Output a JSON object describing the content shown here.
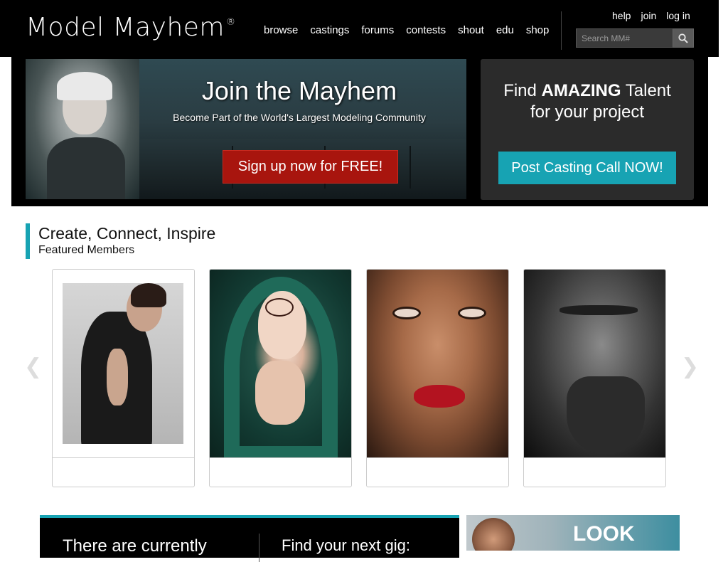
{
  "header": {
    "logo_text": "Model Mayhem",
    "logo_mark": "®",
    "nav": [
      "browse",
      "castings",
      "forums",
      "contests",
      "shout",
      "edu",
      "shop"
    ],
    "user_links": [
      "help",
      "join",
      "log in"
    ],
    "search_placeholder": "Search MM#"
  },
  "hero": {
    "title": "Join the Mayhem",
    "subtitle": "Become Part of the World's Largest Modeling Community",
    "signup_label": "Sign up now for FREE!",
    "talent_prefix": "Find ",
    "talent_emphasis": "AMAZING",
    "talent_suffix": " Talent",
    "talent_line2": "for your project",
    "post_label": "Post Casting Call NOW!"
  },
  "featured": {
    "title": "Create, Connect, Inspire",
    "subtitle": "Featured Members",
    "prev_icon": "chevron-left-icon",
    "next_icon": "chevron-right-icon"
  },
  "bottom": {
    "gig_left": "There are currently",
    "gig_right": "Find your next gig:",
    "look_text": "LOOK"
  },
  "colors": {
    "accent": "#17a3b3",
    "signup": "#a8150e",
    "header_bg": "#000000"
  }
}
